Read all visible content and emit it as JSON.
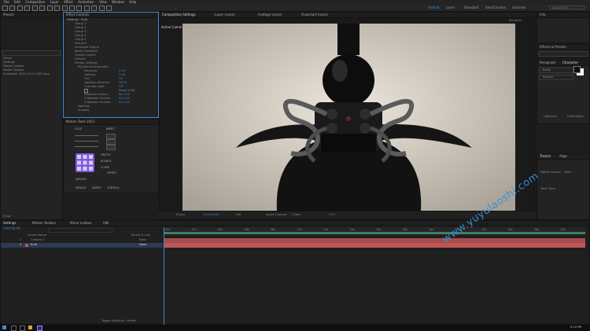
{
  "menubar": {
    "items": [
      "File",
      "Edit",
      "Composition",
      "Layer",
      "Effect",
      "Animation",
      "View",
      "Window",
      "Help"
    ]
  },
  "workspaces": [
    "Default",
    "Learn",
    "Standard",
    "Small Screen",
    "Libraries"
  ],
  "search_placeholder": "Search Help",
  "project_panel": {
    "tab": "Project",
    "items": [
      "Solids",
      "Settings",
      "Motion toolbox",
      "Rotate Toolbox",
      "Animation 2019-10-21 0001.png"
    ],
    "footer": "8 bpc"
  },
  "effect_controls": {
    "tab": "Effect Controls",
    "target": "Settings · Bulb",
    "groups": [
      "Group 1",
      "Group 2",
      "Group 3",
      "Group 4",
      "Group 5",
      "Group 6",
      "Animated Engine",
      "World Transform",
      "Custom Layers",
      "Utilities",
      "Render Settings",
      "Physical Environment"
    ],
    "props": [
      {
        "name": "Exposure",
        "value": "0.00"
      },
      {
        "name": "Gamma",
        "value": "1.00"
      },
      {
        "name": "Tint",
        "value": "On"
      },
      {
        "name": "Lighting Influence",
        "value": "100%"
      },
      {
        "name": "Override Light",
        "value": "Off"
      },
      {
        "name": "Show in BG",
        "value": "Show in BG"
      },
      {
        "name": "Rotation Environ.",
        "value": "0x+0.0°"
      },
      {
        "name": "Y Rotation Environ.",
        "value": "0x+0.0°"
      },
      {
        "name": "Z Rotation Environ.",
        "value": "0x+0.0°"
      }
    ],
    "tail": [
      "Lighting",
      "Shadow",
      "Cameras Settings"
    ]
  },
  "motion_tools": {
    "title": "Motion Tools 2023",
    "labels": [
      "EASE",
      "INPUT",
      "SWITCH",
      "BOUNCE",
      "CLONE",
      "OFFSET",
      "AMOUNT",
      "DEFAULT",
      "INVERT",
      "CONTROL"
    ]
  },
  "composition": {
    "tab": "Composition Settings",
    "viewer_tabs": [
      "Layer (none)",
      "Footage (none)",
      "Flowchart (none)"
    ],
    "view_label": "Active Camera",
    "renderer": "Renderer",
    "footer": {
      "zoom": "(Fully)",
      "time": "0:00:00:00",
      "resolution": "Full",
      "camera": "Active Camera",
      "views": "1 View",
      "exposure": "+0.0"
    }
  },
  "right_panels": {
    "info_tab": "Info",
    "effects_tab": "Effects & Presets",
    "paragraph_tab": "Paragraph",
    "character_tab": "Character",
    "font": "Bodia",
    "weight": "Regular",
    "tracker_tab": "Tracker",
    "align_tab": "Align",
    "motion_source": "Motion Source",
    "track_type": "Track Type",
    "none": "None",
    "ligatures": "Ligatures",
    "hindi_digits": "Hindi Digits"
  },
  "timeline": {
    "tabs": [
      "Settings",
      "Motion Toolbox",
      "Mirror Ledbox",
      "UNI"
    ],
    "time": "0:00:00:00",
    "columns": [
      "Source Name",
      "Parent & Link"
    ],
    "layers": [
      {
        "index": "1",
        "name": "Camera 1",
        "parent": "None"
      },
      {
        "index": "2",
        "name": "Bulb",
        "parent": "None"
      }
    ],
    "ruler": [
      "00s",
      "02s",
      "04s",
      "06s",
      "08s",
      "10s",
      "12s",
      "14s",
      "16s",
      "18s",
      "20s",
      "22s",
      "24s",
      "26s",
      "28s",
      "30s"
    ],
    "footer": "Toggle Switches / Modes"
  },
  "taskbar": {
    "clock": "5:12 PM"
  },
  "watermark": "www.yuyulaoshi.com",
  "colors": {
    "accent": "#3b8cd6",
    "layer_bar": "#c05555",
    "workarea": "#3f7f62"
  }
}
